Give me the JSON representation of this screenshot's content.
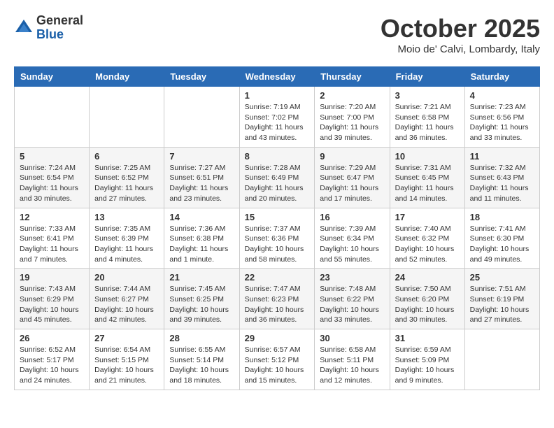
{
  "header": {
    "logo": {
      "general": "General",
      "blue": "Blue"
    },
    "title": "October 2025",
    "location": "Moio de' Calvi, Lombardy, Italy"
  },
  "calendar": {
    "days_of_week": [
      "Sunday",
      "Monday",
      "Tuesday",
      "Wednesday",
      "Thursday",
      "Friday",
      "Saturday"
    ],
    "weeks": [
      {
        "days": [
          {
            "number": "",
            "info": ""
          },
          {
            "number": "",
            "info": ""
          },
          {
            "number": "",
            "info": ""
          },
          {
            "number": "1",
            "info": "Sunrise: 7:19 AM\nSunset: 7:02 PM\nDaylight: 11 hours and 43 minutes."
          },
          {
            "number": "2",
            "info": "Sunrise: 7:20 AM\nSunset: 7:00 PM\nDaylight: 11 hours and 39 minutes."
          },
          {
            "number": "3",
            "info": "Sunrise: 7:21 AM\nSunset: 6:58 PM\nDaylight: 11 hours and 36 minutes."
          },
          {
            "number": "4",
            "info": "Sunrise: 7:23 AM\nSunset: 6:56 PM\nDaylight: 11 hours and 33 minutes."
          }
        ]
      },
      {
        "days": [
          {
            "number": "5",
            "info": "Sunrise: 7:24 AM\nSunset: 6:54 PM\nDaylight: 11 hours and 30 minutes."
          },
          {
            "number": "6",
            "info": "Sunrise: 7:25 AM\nSunset: 6:52 PM\nDaylight: 11 hours and 27 minutes."
          },
          {
            "number": "7",
            "info": "Sunrise: 7:27 AM\nSunset: 6:51 PM\nDaylight: 11 hours and 23 minutes."
          },
          {
            "number": "8",
            "info": "Sunrise: 7:28 AM\nSunset: 6:49 PM\nDaylight: 11 hours and 20 minutes."
          },
          {
            "number": "9",
            "info": "Sunrise: 7:29 AM\nSunset: 6:47 PM\nDaylight: 11 hours and 17 minutes."
          },
          {
            "number": "10",
            "info": "Sunrise: 7:31 AM\nSunset: 6:45 PM\nDaylight: 11 hours and 14 minutes."
          },
          {
            "number": "11",
            "info": "Sunrise: 7:32 AM\nSunset: 6:43 PM\nDaylight: 11 hours and 11 minutes."
          }
        ]
      },
      {
        "days": [
          {
            "number": "12",
            "info": "Sunrise: 7:33 AM\nSunset: 6:41 PM\nDaylight: 11 hours and 7 minutes."
          },
          {
            "number": "13",
            "info": "Sunrise: 7:35 AM\nSunset: 6:39 PM\nDaylight: 11 hours and 4 minutes."
          },
          {
            "number": "14",
            "info": "Sunrise: 7:36 AM\nSunset: 6:38 PM\nDaylight: 11 hours and 1 minute."
          },
          {
            "number": "15",
            "info": "Sunrise: 7:37 AM\nSunset: 6:36 PM\nDaylight: 10 hours and 58 minutes."
          },
          {
            "number": "16",
            "info": "Sunrise: 7:39 AM\nSunset: 6:34 PM\nDaylight: 10 hours and 55 minutes."
          },
          {
            "number": "17",
            "info": "Sunrise: 7:40 AM\nSunset: 6:32 PM\nDaylight: 10 hours and 52 minutes."
          },
          {
            "number": "18",
            "info": "Sunrise: 7:41 AM\nSunset: 6:30 PM\nDaylight: 10 hours and 49 minutes."
          }
        ]
      },
      {
        "days": [
          {
            "number": "19",
            "info": "Sunrise: 7:43 AM\nSunset: 6:29 PM\nDaylight: 10 hours and 45 minutes."
          },
          {
            "number": "20",
            "info": "Sunrise: 7:44 AM\nSunset: 6:27 PM\nDaylight: 10 hours and 42 minutes."
          },
          {
            "number": "21",
            "info": "Sunrise: 7:45 AM\nSunset: 6:25 PM\nDaylight: 10 hours and 39 minutes."
          },
          {
            "number": "22",
            "info": "Sunrise: 7:47 AM\nSunset: 6:23 PM\nDaylight: 10 hours and 36 minutes."
          },
          {
            "number": "23",
            "info": "Sunrise: 7:48 AM\nSunset: 6:22 PM\nDaylight: 10 hours and 33 minutes."
          },
          {
            "number": "24",
            "info": "Sunrise: 7:50 AM\nSunset: 6:20 PM\nDaylight: 10 hours and 30 minutes."
          },
          {
            "number": "25",
            "info": "Sunrise: 7:51 AM\nSunset: 6:19 PM\nDaylight: 10 hours and 27 minutes."
          }
        ]
      },
      {
        "days": [
          {
            "number": "26",
            "info": "Sunrise: 6:52 AM\nSunset: 5:17 PM\nDaylight: 10 hours and 24 minutes."
          },
          {
            "number": "27",
            "info": "Sunrise: 6:54 AM\nSunset: 5:15 PM\nDaylight: 10 hours and 21 minutes."
          },
          {
            "number": "28",
            "info": "Sunrise: 6:55 AM\nSunset: 5:14 PM\nDaylight: 10 hours and 18 minutes."
          },
          {
            "number": "29",
            "info": "Sunrise: 6:57 AM\nSunset: 5:12 PM\nDaylight: 10 hours and 15 minutes."
          },
          {
            "number": "30",
            "info": "Sunrise: 6:58 AM\nSunset: 5:11 PM\nDaylight: 10 hours and 12 minutes."
          },
          {
            "number": "31",
            "info": "Sunrise: 6:59 AM\nSunset: 5:09 PM\nDaylight: 10 hours and 9 minutes."
          },
          {
            "number": "",
            "info": ""
          }
        ]
      }
    ]
  }
}
